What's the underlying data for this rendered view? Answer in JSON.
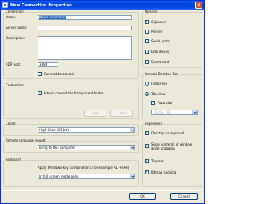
{
  "window": {
    "title": "New Connection Properties",
    "close_label": "×"
  },
  "connection": {
    "legend": "Connection",
    "name_label": "Name:",
    "name_value": "New Connection",
    "server_label": "Server name:",
    "server_value": "",
    "description_label": "Description:",
    "description_value": "",
    "rdp_port_label": "RDP port:",
    "rdp_port_value": "3389",
    "connect_console_label": "Connect to console"
  },
  "credentials": {
    "legend": "Credentials",
    "inherit_label": "Inherit credentials from parent folder",
    "set_button": "Set",
    "clear_button": "Clear"
  },
  "colors": {
    "legend": "Colors",
    "selected": "High Color (16 bit)"
  },
  "sound": {
    "legend": "Remote computer sound",
    "selected": "Bring to this computer"
  },
  "keyboard": {
    "legend": "Keyboard",
    "apply_label": "Apply Windows key combinations (for example ALT+TAB)",
    "selected": "In full screen mode only"
  },
  "options": {
    "legend": "Options",
    "items": [
      "Clipboard",
      "Printer",
      "Serial ports",
      "Disk drives",
      "Smart card"
    ]
  },
  "desktop_size": {
    "legend": "Remote Desktop Size",
    "fullscreen_label": "Fullscreen",
    "tab_view_label": "Tab View",
    "auto_size_label": "Auto size",
    "size_value": "1024 x 768"
  },
  "experience": {
    "legend": "Experience",
    "desktop_background": "Desktop background",
    "show_contents": "Show contents of window while dragging",
    "themes": "Themes",
    "bitmap_caching": "Bitmap caching"
  },
  "footer": {
    "ok_button": "OK",
    "cancel_button": "Cancel"
  }
}
